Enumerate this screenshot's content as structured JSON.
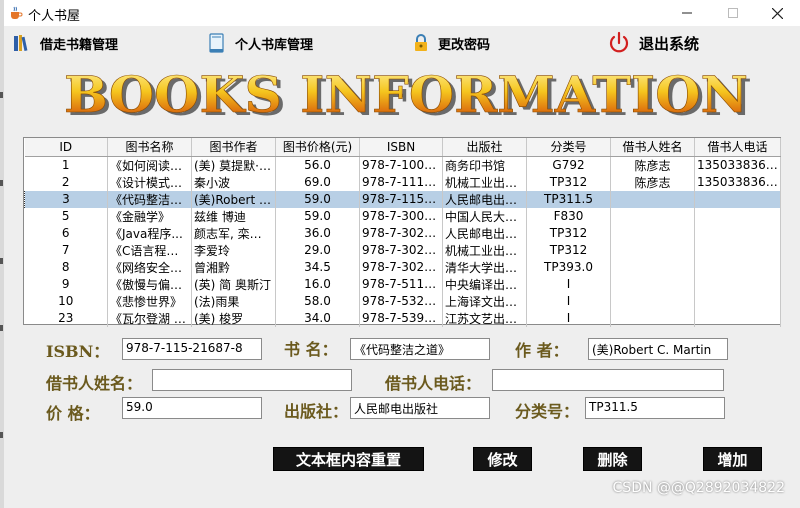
{
  "window": {
    "title": "个人书屋"
  },
  "menu": [
    {
      "label": "借走书籍管理",
      "icon": "books-icon"
    },
    {
      "label": "个人书库管理",
      "icon": "book-icon"
    },
    {
      "label": "更改密码",
      "icon": "lock-icon"
    },
    {
      "label": "退出系统",
      "icon": "power-icon"
    }
  ],
  "banner": {
    "text": "BOOKS INFORMATION"
  },
  "table": {
    "headers": [
      "ID",
      "图书名称",
      "图书作者",
      "图书价格(元)",
      "ISBN",
      "出版社",
      "分类号",
      "借书人姓名",
      "借书人电话"
    ],
    "rows": [
      [
        "1",
        "《如何阅读一...",
        "(美) 莫提默·J....",
        "56.0",
        "978-7-100-1...",
        "商务印书馆",
        "G792",
        "陈彦志",
        "13503383632"
      ],
      [
        "2",
        "《设计模式之...",
        "秦小波",
        "69.0",
        "978-7-111-2...",
        "机械工业出版...",
        "TP312",
        "陈彦志",
        "13503383632"
      ],
      [
        "3",
        "《代码整洁之...",
        "(美)Robert C....",
        "59.0",
        "978-7-115-2...",
        "人民邮电出版...",
        "TP311.5",
        "",
        ""
      ],
      [
        "5",
        "《金融学》",
        "兹维 博迪",
        "59.0",
        "978-7-300-1...",
        "中国人民大学...",
        "F830",
        "",
        ""
      ],
      [
        "6",
        "《Java程序...",
        "颜志军, 栾媛媛",
        "36.0",
        "978-7-302-2...",
        "人民邮电出版...",
        "TP312",
        "",
        ""
      ],
      [
        "7",
        "《C语言程序...",
        "李爱玲",
        "29.0",
        "978-7-302-2...",
        "机械工业出版...",
        "TP312",
        "",
        ""
      ],
      [
        "8",
        "《网络安全技...",
        "曾湘黔",
        "34.5",
        "978-7-302-2...",
        "清华大学出版...",
        "TP393.0",
        "",
        ""
      ],
      [
        "9",
        "《傲慢与偏见...",
        "(英) 简 奥斯汀",
        "16.0",
        "978-7-5117-...",
        "中央编译出版...",
        "I",
        "",
        ""
      ],
      [
        "10",
        "《悲惨世界》",
        "(法)雨果",
        "58.0",
        "978-7-5327-...",
        "上海译文出版...",
        "I",
        "",
        ""
      ],
      [
        "23",
        "《瓦尔登湖 : ...",
        "(美) 梭罗",
        "34.0",
        "978-7-5399-...",
        "江苏文艺出版...",
        "I",
        "",
        ""
      ]
    ],
    "selected_index": 2
  },
  "form": {
    "isbn_label": "ISBN：",
    "isbn_value": "978-7-115-21687-8",
    "title_label": "书   名：",
    "title_value": "《代码整洁之道》",
    "author_label": "作   者：",
    "author_value": "(美)Robert C. Martin",
    "borrower_name_label": "借书人姓名：",
    "borrower_name_value": "",
    "borrower_phone_label": "借书人电话：",
    "borrower_phone_value": "",
    "price_label": "价    格：",
    "price_value": "59.0",
    "publisher_label": "出版社：",
    "publisher_value": "人民邮电出版社",
    "category_label": "分类号：",
    "category_value": "TP311.5"
  },
  "buttons": {
    "reset": "文本框内容重置",
    "modify": "修改",
    "delete": "删除",
    "add": "增加"
  },
  "watermark": "CSDN @@Q2892034822"
}
